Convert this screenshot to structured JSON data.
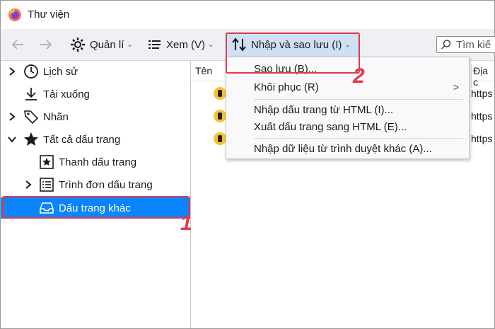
{
  "window": {
    "title": "Thư viện"
  },
  "toolbar": {
    "back_icon": "back-arrow-icon",
    "forward_icon": "forward-arrow-icon",
    "manage_label": "Quản lí",
    "view_label": "Xem (V)",
    "import_label": "Nhập và sao lưu (I)",
    "search_placeholder": "Tìm kiế"
  },
  "sidebar": {
    "items": [
      {
        "label": "Lịch sử",
        "icon": "clock-icon"
      },
      {
        "label": "Tải xuống",
        "icon": "download-icon"
      },
      {
        "label": "Nhãn",
        "icon": "tag-icon"
      },
      {
        "label": "Tất cả dấu trang",
        "icon": "star-icon"
      },
      {
        "label": "Thanh dấu trang",
        "icon": "star-box-icon"
      },
      {
        "label": "Trình đơn dấu trang",
        "icon": "menu-list-icon"
      },
      {
        "label": "Dấu trang khác",
        "icon": "inbox-icon"
      }
    ]
  },
  "content": {
    "columns": [
      "Tên",
      "Địa c"
    ],
    "rows": [
      {
        "url": "https"
      },
      {
        "url": "https"
      },
      {
        "url": "https"
      }
    ]
  },
  "menu": {
    "items": [
      {
        "label": "Sao lưu (B)..."
      },
      {
        "label": "Khôi phục (R)",
        "submenu_indicator": ">"
      },
      {
        "label": "Nhập dấu trang từ HTML (I)..."
      },
      {
        "label": "Xuất dấu trang sang HTML (E)..."
      },
      {
        "label": "Nhập dữ liệu từ trình duyệt khác (A)..."
      }
    ]
  },
  "annotations": {
    "step1": "1",
    "step2": "2",
    "accent_color": "#e23a4a",
    "selection_color": "#0a84ff"
  }
}
